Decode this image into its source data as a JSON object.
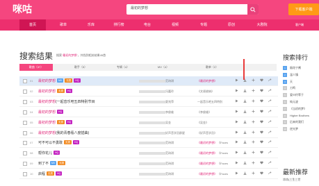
{
  "header": {
    "logo_text": "咪咕",
    "logo_sub": "音 乐 随 身",
    "search_query": "最初的梦想",
    "download_label": "下载客户端"
  },
  "nav": {
    "items": [
      "首页",
      "歌单",
      "乐库",
      "排行榜",
      "电台",
      "视频",
      "专题",
      "原创",
      "大剧院"
    ],
    "client_label": "客户端"
  },
  "results": {
    "title": "搜索结果",
    "subtitle_prefix": "搜索",
    "keyword": "“最初的梦想”",
    "subtitle_suffix": "共找到相关结果45首",
    "tabs": [
      "歌曲（37）",
      "歌手（5）",
      "专辑（4）",
      "MV（4）",
      "歌单（2）"
    ],
    "rows": [
      {
        "num": "01",
        "title_kw": "最初的梦想",
        "rest": "",
        "badges": [
          "MV",
          "无损",
          "HQ"
        ],
        "artist": "范玮琪",
        "album_kw": "最初的梦想",
        "album_rest": ""
      },
      {
        "num": "02",
        "title_kw": "最初的梦想",
        "rest": "",
        "badges": [
          "无损",
          "HQ"
        ],
        "artist": "冯嘉玲",
        "album_kw": "",
        "album_rest": "《文颂收纳》"
      },
      {
        "num": "03",
        "title_kw": "最初的梦想",
        "rest": "(一起音乐吧五四特别节目",
        "badges": [],
        "artist": "夏兆萍",
        "album_kw": "",
        "album_rest": "一起音乐吧五四特别"
      },
      {
        "num": "04",
        "title_kw": "最初的梦想",
        "rest": "",
        "badges": [
          "HQ"
        ],
        "artist": "李俊维",
        "album_kw": "",
        "album_rest": "《李俊维》"
      },
      {
        "num": "05",
        "title_kw": "最初的梦想",
        "rest": "",
        "badges": [
          "无损",
          "HQ"
        ],
        "artist": "吴金",
        "album_kw": "",
        "album_rest": "《吴金》"
      },
      {
        "num": "06",
        "title_kw": "最初的梦想",
        "rest": "(我的青春看八度插曲)",
        "badges": [],
        "artist": "好声音学员群星",
        "album_kw": "",
        "album_rest": "《好声音学员》"
      },
      {
        "num": "07",
        "title_kw": "",
        "rest": "可不可以不勇敢",
        "badges": [
          "无损",
          "HQ"
        ],
        "artist": "范玮琪",
        "album_kw": "最初的梦想",
        "album_rest": "《Faces"
      },
      {
        "num": "08",
        "title_kw": "",
        "rest": "帮你花儿",
        "badges": [
          "HQ"
        ],
        "artist": "范玮琪",
        "album_kw": "最初的梦想",
        "album_rest": "《Faces"
      },
      {
        "num": "09",
        "title_kw": "",
        "rest": "到了不",
        "badges": [
          "MV",
          "无损"
        ],
        "artist": "范玮琪",
        "album_kw": "最初的梦想",
        "album_rest": "《Faces"
      },
      {
        "num": "10",
        "title_kw": "",
        "rest": "启程",
        "badges": [
          "无损",
          "HQ"
        ],
        "artist": "范玮琪",
        "album_kw": "最初的梦想",
        "album_rest": "《Faces"
      }
    ]
  },
  "sidebar": {
    "title": "搜索排行",
    "items": [
      "烟花宁酱",
      "温人镇",
      "天",
      "刀鸣",
      "爱曰约等于",
      "纯元波",
      "《当初的梦》",
      "Higher Brothers",
      "后来的我们",
      "逆光梦"
    ],
    "title2": "最新推荐",
    "last_item": "凉凉(三生三世"
  },
  "colors": {
    "brand": "#f5467f",
    "nav": "#ed2f6e",
    "keyword": "#e0287a",
    "mv": "#5aa4ef",
    "hq": "#c321c0",
    "lossless": "#f28a21"
  }
}
